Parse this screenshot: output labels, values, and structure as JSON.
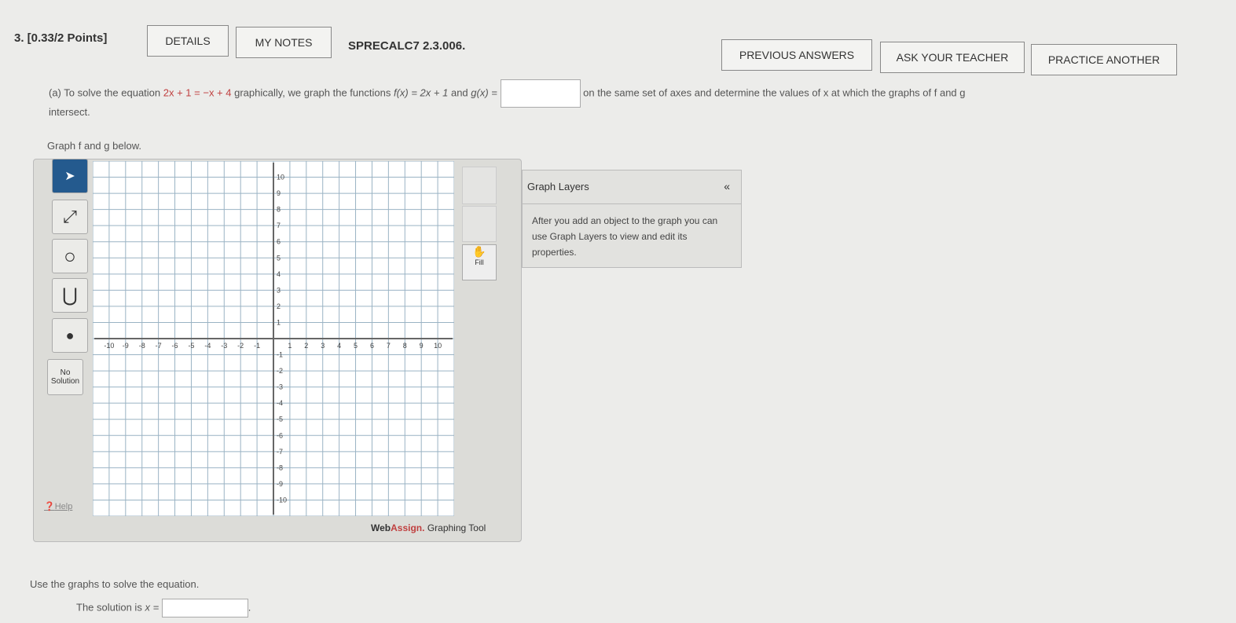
{
  "header": {
    "question": "3. [0.33/2 Points]",
    "details": "DETAILS",
    "notes": "MY NOTES",
    "code": "SPRECALC7 2.3.006.",
    "previous": "PREVIOUS ANSWERS",
    "ask": "ASK YOUR TEACHER",
    "practice": "PRACTICE ANOTHER"
  },
  "problem": {
    "part_a": "(a) To solve the equation",
    "equation": "2x + 1 = −x + 4",
    "mid": "graphically, we graph the functions",
    "f": "f(x) = 2x + 1",
    "and": "and",
    "g": "g(x) =",
    "g_value": "",
    "rest": "on the same set of axes and determine the values of x at which the graphs of f and g",
    "rest2": "intersect.",
    "graph_prompt": "Graph f and g below."
  },
  "tool": {
    "no_solution": "No Solution",
    "help": "Help",
    "fill": "Fill",
    "brand_web": "Web",
    "brand_assign": "Assign.",
    "brand_tool": "Graphing Tool",
    "layers_title": "Graph Layers",
    "layers_collapse": "«",
    "layers_text": "After you add an object to the graph you can use Graph Layers to view and edit its properties."
  },
  "graph": {
    "xmin": -10,
    "xmax": 10,
    "ymin": -10,
    "ymax": 10
  },
  "solve": {
    "prompt": "Use the graphs to solve the equation.",
    "label": "The solution is",
    "var": "x =",
    "value": ""
  }
}
